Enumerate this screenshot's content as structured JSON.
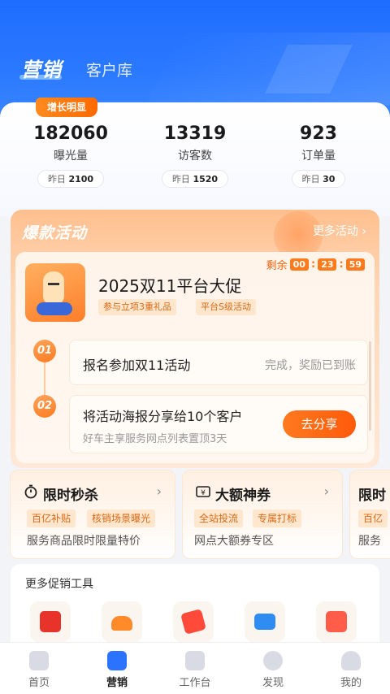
{
  "header": {
    "tab_active": "营销",
    "tab_other": "客户库"
  },
  "stats": {
    "badge": "增长明显",
    "items": [
      {
        "value": "182060",
        "label": "曝光量",
        "yday_prefix": "昨日",
        "yday_value": "2100"
      },
      {
        "value": "13319",
        "label": "访客数",
        "yday_prefix": "昨日",
        "yday_value": "1520"
      },
      {
        "value": "923",
        "label": "订单量",
        "yday_prefix": "昨日",
        "yday_value": "30"
      }
    ]
  },
  "hot": {
    "title": "爆款活动",
    "more": "更多活动 ›",
    "promo_title": "2025双11平台大促",
    "tags": [
      "参与立项3重礼品",
      "平台S级活动"
    ],
    "countdown_prefix": "剩余",
    "countdown": [
      "00",
      "23",
      "59"
    ],
    "steps": [
      {
        "num": "01",
        "text": "报名参加双11活动",
        "status": "完成，奖励已到账"
      },
      {
        "num": "02",
        "text": "将活动海报分享给10个客户",
        "sub": "好车主享服务网点列表置顶3天",
        "button": "去分享"
      }
    ]
  },
  "cards": [
    {
      "title": "限时秒杀",
      "tags": [
        "百亿补贴",
        "核销场景曝光"
      ],
      "desc": "服务商品限时限量特价"
    },
    {
      "title": "大额神券",
      "tags": [
        "全站投流",
        "专属打标"
      ],
      "desc": "网点大额券专区"
    },
    {
      "title": "限时",
      "tags": [
        "百亿"
      ],
      "desc": "服务"
    }
  ],
  "tools": {
    "title": "更多促销工具",
    "icons": [
      "red-envelope-icon",
      "car-icon",
      "discount-ticket-icon",
      "card-icon",
      "store-icon"
    ]
  },
  "nav": [
    {
      "label": "首页",
      "icon": "home-icon"
    },
    {
      "label": "营销",
      "icon": "marketing-icon"
    },
    {
      "label": "工作台",
      "icon": "workbench-icon"
    },
    {
      "label": "发现",
      "icon": "discover-icon"
    },
    {
      "label": "我的",
      "icon": "profile-icon"
    }
  ]
}
